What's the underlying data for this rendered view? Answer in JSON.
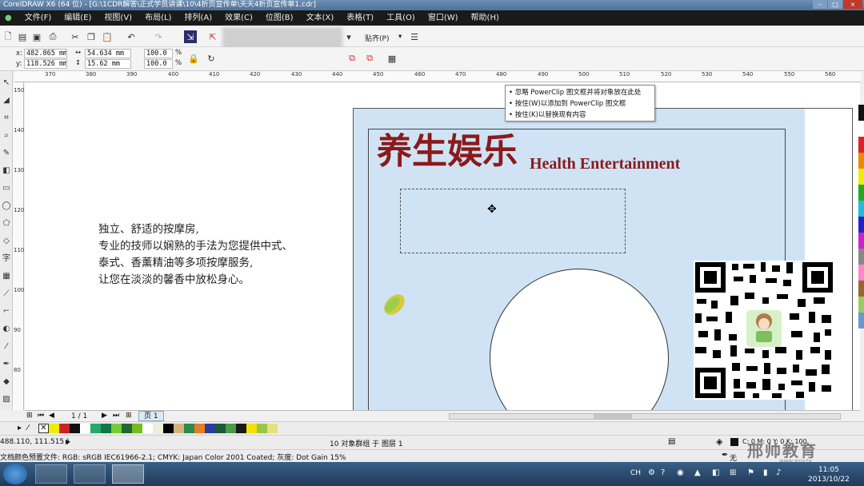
{
  "window": {
    "title": "CorelDRAW X6 (64 位) - [G:\\1CDR解答\\正式学员讲课\\10\\4折页宣传单\\天天4折页宣传单1.cdr]",
    "controls": [
      "–",
      "□",
      "×"
    ]
  },
  "menu": [
    "文件(F)",
    "编辑(E)",
    "视图(V)",
    "布局(L)",
    "排列(A)",
    "效果(C)",
    "位图(B)",
    "文本(X)",
    "表格(T)",
    "工具(O)",
    "窗口(W)",
    "帮助(H)"
  ],
  "toolbar": {
    "snap_label": "贴齐(P)",
    "snap_arrow": "▾"
  },
  "property_bar": {
    "x_label": "x:",
    "x_value": "482.865 mm",
    "y_label": "y:",
    "y_value": "118.526 mm",
    "w_value": "54.634 mm",
    "h_value": "15.62 mm",
    "scale_w": "100.0",
    "scale_h": "100.0",
    "percent": "%"
  },
  "ruler": {
    "ticks": [
      "370",
      "380",
      "390",
      "400",
      "410",
      "420",
      "430",
      "440",
      "450",
      "460",
      "470",
      "480",
      "490",
      "500",
      "510",
      "520",
      "530",
      "540",
      "550",
      "560"
    ],
    "vticks": [
      "150",
      "140",
      "130",
      "120",
      "110",
      "100",
      "90",
      "80"
    ]
  },
  "tooltip": {
    "lines": [
      "• 忽略 PowerClip 图文框并将对象放在此处",
      "• 按住(W)以添加到 PowerClip 图文框",
      "• 按住(K)以替换现有内容"
    ]
  },
  "canvas": {
    "body_text": [
      "独立、舒适的按摩房,",
      "专业的技师以娴熟的手法为您提供中式、",
      "泰式、香薰精油等多项按摩服务,",
      "让您在淡淡的馨香中放松身心。"
    ],
    "heading_cn": "养生娱乐",
    "heading_en": "Health Entertainment",
    "move_cursor": "✥"
  },
  "pagebar": {
    "page_count": "1 / 1",
    "page_tab": "页 1"
  },
  "status": {
    "cursor_pos": "488.110, 111.515 )",
    "selection_info": "10 对象群组 于 图层 1",
    "fill_info": "C: 0 M: 0 Y: 0 K: 100",
    "outline_label": "无",
    "color_profile": "文档颜色预置文件: RGB: sRGB IEC61966-2.1; CMYK: Japan Color 2001 Coated; 灰度: Dot Gain 15%"
  },
  "watermark": {
    "logo_text": "邢帅教育",
    "logo_sub": "www.xsjy.tv"
  },
  "taskbar": {
    "lang": "CH",
    "time": "11:05",
    "date": "2013/10/22"
  },
  "colors": {
    "accent_heading": "#8b1a1a",
    "page_bg": "#cfe3f5",
    "menubar_bg": "#1a1a1a"
  }
}
